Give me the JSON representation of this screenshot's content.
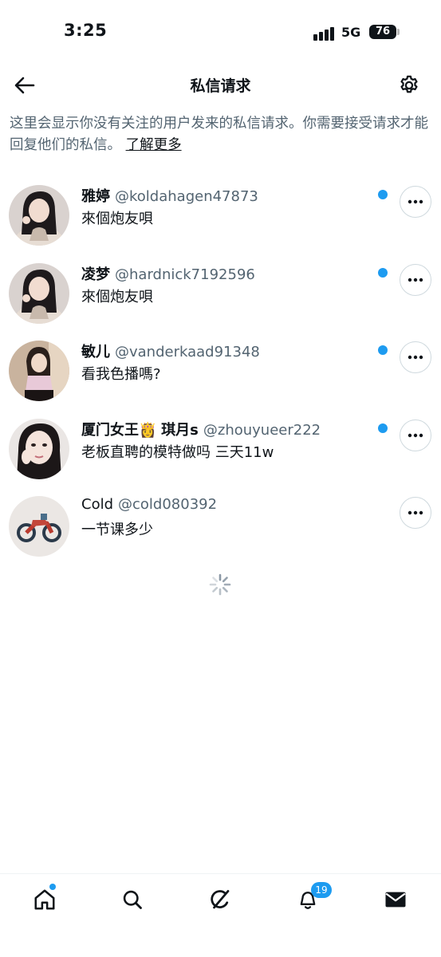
{
  "status_bar": {
    "time": "3:25",
    "network": "5G",
    "battery": "76"
  },
  "header": {
    "title": "私信请求",
    "back_icon": "back-arrow-icon",
    "settings_icon": "gear-icon"
  },
  "info": {
    "text": "这里会显示你没有关注的用户发来的私信请求。你需要接受请求才能回复他们的私信。",
    "link": "了解更多"
  },
  "requests": [
    {
      "name": "雅婷",
      "handle": "@koldahagen47873",
      "message": "來個炮友唄",
      "unread": true
    },
    {
      "name": "凌梦",
      "handle": "@hardnick7192596",
      "message": "來個炮友唄",
      "unread": true
    },
    {
      "name": "敏儿",
      "handle": "@vanderkaad91348",
      "message": "看我色播嗎?",
      "unread": true
    },
    {
      "name_part1": "厦门女王",
      "crown": "👸",
      "name_part2": "琪月s",
      "handle": "@zhouyueer222",
      "message": "老板直聘的模特做吗 三天11w",
      "unread": true
    },
    {
      "name": "Cold",
      "handle": "@cold080392",
      "message": "一节课多少",
      "unread": false
    }
  ],
  "nav": {
    "items": [
      "home-icon",
      "search-icon",
      "grok-icon",
      "notifications-icon",
      "messages-icon"
    ],
    "notifications_badge": "19"
  },
  "colors": {
    "accent": "#1d9bf0",
    "secondary_text": "#536471",
    "border": "#cfd9de"
  }
}
